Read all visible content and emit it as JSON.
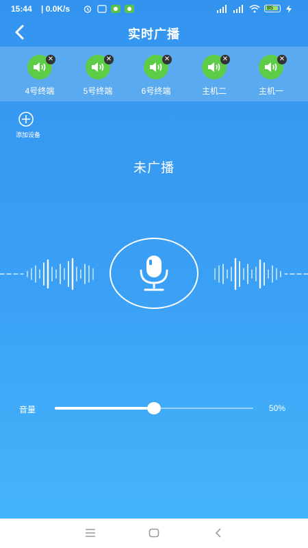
{
  "statusbar": {
    "time": "15:44",
    "net_speed": "| 0.0K/s",
    "battery": "85"
  },
  "header": {
    "title": "实时广播"
  },
  "devices": [
    {
      "label": "4号终端"
    },
    {
      "label": "5号终端"
    },
    {
      "label": "6号终端"
    },
    {
      "label": "主机二"
    },
    {
      "label": "主机一"
    }
  ],
  "device_remove_glyph": "✕",
  "add_device": {
    "label": "添加设备"
  },
  "broadcast": {
    "status": "未广播"
  },
  "volume": {
    "label": "音量",
    "value_text": "50%",
    "level": 0.5
  },
  "colors": {
    "background": "#3aa0f5",
    "device_icon": "#5dcc47",
    "device_strip": "#5aaaf0"
  },
  "icons": [
    "back-arrow-icon",
    "speaker-icon",
    "remove-icon",
    "add-circle-icon",
    "microphone-icon",
    "menu-icon",
    "home-icon",
    "back-icon"
  ]
}
